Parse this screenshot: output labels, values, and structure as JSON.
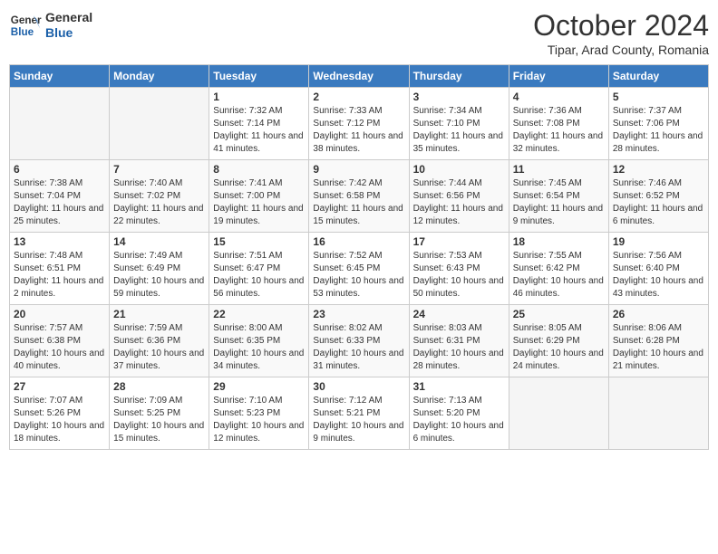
{
  "header": {
    "logo_line1": "General",
    "logo_line2": "Blue",
    "month_title": "October 2024",
    "location": "Tipar, Arad County, Romania"
  },
  "days_of_week": [
    "Sunday",
    "Monday",
    "Tuesday",
    "Wednesday",
    "Thursday",
    "Friday",
    "Saturday"
  ],
  "weeks": [
    [
      {
        "num": "",
        "empty": true
      },
      {
        "num": "",
        "empty": true
      },
      {
        "num": "1",
        "sunrise": "Sunrise: 7:32 AM",
        "sunset": "Sunset: 7:14 PM",
        "daylight": "Daylight: 11 hours and 41 minutes."
      },
      {
        "num": "2",
        "sunrise": "Sunrise: 7:33 AM",
        "sunset": "Sunset: 7:12 PM",
        "daylight": "Daylight: 11 hours and 38 minutes."
      },
      {
        "num": "3",
        "sunrise": "Sunrise: 7:34 AM",
        "sunset": "Sunset: 7:10 PM",
        "daylight": "Daylight: 11 hours and 35 minutes."
      },
      {
        "num": "4",
        "sunrise": "Sunrise: 7:36 AM",
        "sunset": "Sunset: 7:08 PM",
        "daylight": "Daylight: 11 hours and 32 minutes."
      },
      {
        "num": "5",
        "sunrise": "Sunrise: 7:37 AM",
        "sunset": "Sunset: 7:06 PM",
        "daylight": "Daylight: 11 hours and 28 minutes."
      }
    ],
    [
      {
        "num": "6",
        "sunrise": "Sunrise: 7:38 AM",
        "sunset": "Sunset: 7:04 PM",
        "daylight": "Daylight: 11 hours and 25 minutes."
      },
      {
        "num": "7",
        "sunrise": "Sunrise: 7:40 AM",
        "sunset": "Sunset: 7:02 PM",
        "daylight": "Daylight: 11 hours and 22 minutes."
      },
      {
        "num": "8",
        "sunrise": "Sunrise: 7:41 AM",
        "sunset": "Sunset: 7:00 PM",
        "daylight": "Daylight: 11 hours and 19 minutes."
      },
      {
        "num": "9",
        "sunrise": "Sunrise: 7:42 AM",
        "sunset": "Sunset: 6:58 PM",
        "daylight": "Daylight: 11 hours and 15 minutes."
      },
      {
        "num": "10",
        "sunrise": "Sunrise: 7:44 AM",
        "sunset": "Sunset: 6:56 PM",
        "daylight": "Daylight: 11 hours and 12 minutes."
      },
      {
        "num": "11",
        "sunrise": "Sunrise: 7:45 AM",
        "sunset": "Sunset: 6:54 PM",
        "daylight": "Daylight: 11 hours and 9 minutes."
      },
      {
        "num": "12",
        "sunrise": "Sunrise: 7:46 AM",
        "sunset": "Sunset: 6:52 PM",
        "daylight": "Daylight: 11 hours and 6 minutes."
      }
    ],
    [
      {
        "num": "13",
        "sunrise": "Sunrise: 7:48 AM",
        "sunset": "Sunset: 6:51 PM",
        "daylight": "Daylight: 11 hours and 2 minutes."
      },
      {
        "num": "14",
        "sunrise": "Sunrise: 7:49 AM",
        "sunset": "Sunset: 6:49 PM",
        "daylight": "Daylight: 10 hours and 59 minutes."
      },
      {
        "num": "15",
        "sunrise": "Sunrise: 7:51 AM",
        "sunset": "Sunset: 6:47 PM",
        "daylight": "Daylight: 10 hours and 56 minutes."
      },
      {
        "num": "16",
        "sunrise": "Sunrise: 7:52 AM",
        "sunset": "Sunset: 6:45 PM",
        "daylight": "Daylight: 10 hours and 53 minutes."
      },
      {
        "num": "17",
        "sunrise": "Sunrise: 7:53 AM",
        "sunset": "Sunset: 6:43 PM",
        "daylight": "Daylight: 10 hours and 50 minutes."
      },
      {
        "num": "18",
        "sunrise": "Sunrise: 7:55 AM",
        "sunset": "Sunset: 6:42 PM",
        "daylight": "Daylight: 10 hours and 46 minutes."
      },
      {
        "num": "19",
        "sunrise": "Sunrise: 7:56 AM",
        "sunset": "Sunset: 6:40 PM",
        "daylight": "Daylight: 10 hours and 43 minutes."
      }
    ],
    [
      {
        "num": "20",
        "sunrise": "Sunrise: 7:57 AM",
        "sunset": "Sunset: 6:38 PM",
        "daylight": "Daylight: 10 hours and 40 minutes."
      },
      {
        "num": "21",
        "sunrise": "Sunrise: 7:59 AM",
        "sunset": "Sunset: 6:36 PM",
        "daylight": "Daylight: 10 hours and 37 minutes."
      },
      {
        "num": "22",
        "sunrise": "Sunrise: 8:00 AM",
        "sunset": "Sunset: 6:35 PM",
        "daylight": "Daylight: 10 hours and 34 minutes."
      },
      {
        "num": "23",
        "sunrise": "Sunrise: 8:02 AM",
        "sunset": "Sunset: 6:33 PM",
        "daylight": "Daylight: 10 hours and 31 minutes."
      },
      {
        "num": "24",
        "sunrise": "Sunrise: 8:03 AM",
        "sunset": "Sunset: 6:31 PM",
        "daylight": "Daylight: 10 hours and 28 minutes."
      },
      {
        "num": "25",
        "sunrise": "Sunrise: 8:05 AM",
        "sunset": "Sunset: 6:29 PM",
        "daylight": "Daylight: 10 hours and 24 minutes."
      },
      {
        "num": "26",
        "sunrise": "Sunrise: 8:06 AM",
        "sunset": "Sunset: 6:28 PM",
        "daylight": "Daylight: 10 hours and 21 minutes."
      }
    ],
    [
      {
        "num": "27",
        "sunrise": "Sunrise: 7:07 AM",
        "sunset": "Sunset: 5:26 PM",
        "daylight": "Daylight: 10 hours and 18 minutes."
      },
      {
        "num": "28",
        "sunrise": "Sunrise: 7:09 AM",
        "sunset": "Sunset: 5:25 PM",
        "daylight": "Daylight: 10 hours and 15 minutes."
      },
      {
        "num": "29",
        "sunrise": "Sunrise: 7:10 AM",
        "sunset": "Sunset: 5:23 PM",
        "daylight": "Daylight: 10 hours and 12 minutes."
      },
      {
        "num": "30",
        "sunrise": "Sunrise: 7:12 AM",
        "sunset": "Sunset: 5:21 PM",
        "daylight": "Daylight: 10 hours and 9 minutes."
      },
      {
        "num": "31",
        "sunrise": "Sunrise: 7:13 AM",
        "sunset": "Sunset: 5:20 PM",
        "daylight": "Daylight: 10 hours and 6 minutes."
      },
      {
        "num": "",
        "empty": true
      },
      {
        "num": "",
        "empty": true
      }
    ]
  ]
}
